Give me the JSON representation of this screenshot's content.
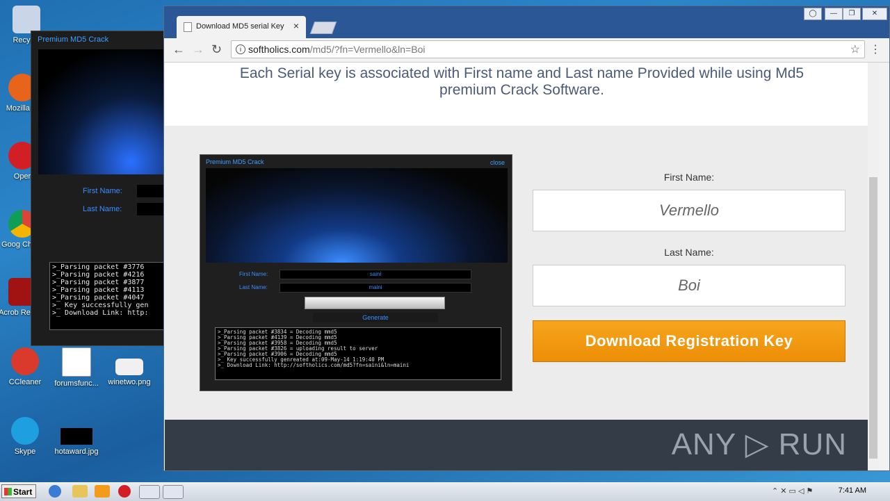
{
  "desktop": {
    "icons": [
      {
        "label": "Recycle",
        "color": "#c9d6e8"
      },
      {
        "label": "Mozilla Fi",
        "color": "#e8641a"
      },
      {
        "label": "Oper",
        "color": "#d21f26"
      },
      {
        "label": "Goog Chron",
        "color": "#3a8c3a"
      },
      {
        "label": "Acrob Reader",
        "color": "#a11313"
      },
      {
        "label": "CCleaner",
        "color": "#d93a2b"
      },
      {
        "label": "Skype",
        "color": "#1d9fe0"
      },
      {
        "label": "forumsfunc...",
        "color": "#ffffff"
      },
      {
        "label": "winetwo.png",
        "color": "#f0f0f0"
      },
      {
        "label": "hotaward.jpg",
        "color": "#000000"
      }
    ]
  },
  "bg_window": {
    "title": "Premium MD5  Crack",
    "first_label": "First Name:",
    "last_label": "Last Name:",
    "console": ">_Parsing packet #3776\n>_Parsing packet #4216\n>_Parsing packet #3877\n>_Parsing packet #4113\n>_Parsing packet #4047\n>_ Key successfully gen\n>_ Download Link: http:"
  },
  "browser": {
    "tab_title": "Download MD5 serial Key",
    "url_domain": "softholics.com",
    "url_path": "/md5/?fn=Vermello&ln=Boi"
  },
  "page": {
    "headline_1": "Each Serial key is associated with First name and Last name Provided while using Md5",
    "headline_2": "premium Crack Software.",
    "shot": {
      "title": "Premium MD5  Crack",
      "close": "close",
      "first_label": "First Name:",
      "first_value": "saini",
      "last_label": "Last Name:",
      "last_value": "maini",
      "generate": "Generate",
      "console": ">_Parsing packet #3834 = Decoding mmd5\n>_Parsing packet #4139 = Decoding mmd5\n>_Parsing packet #3958 = Decoding mmd5\n>_Parsing packet #3826 = uploading result to server\n>_Parsing packet #3906 = Decoding mmd5\n>_ Key successfully genreated at:09-May-14 1:19:40 PM\n>_ Download Link: http://softholics.com/md5?fn=saini&ln=maini"
    },
    "form": {
      "first_label": "First Name:",
      "first_value": "Vermello",
      "last_label": "Last Name:",
      "last_value": "Boi",
      "download_label": "Download Registration Key"
    },
    "footer_logo": "ANY ▷ RUN"
  },
  "taskbar": {
    "start_label": "Start",
    "clock": "7:41 AM"
  }
}
